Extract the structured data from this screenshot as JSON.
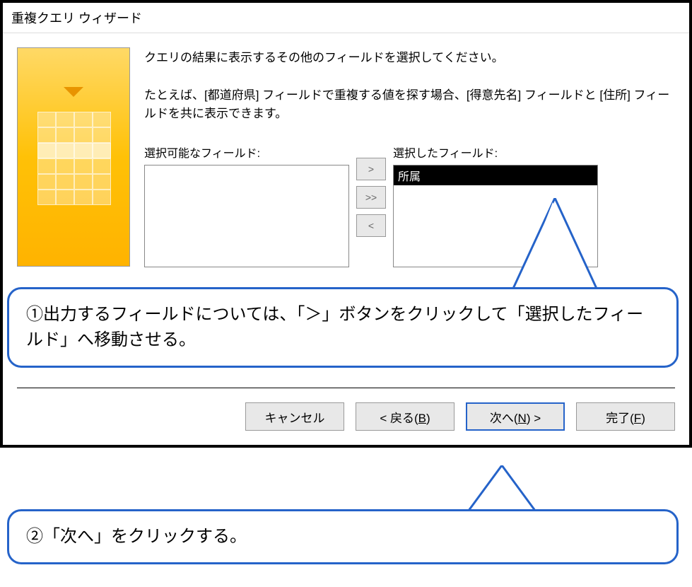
{
  "window": {
    "title": "重複クエリ ウィザード"
  },
  "instruction": "クエリの結果に表示するその他のフィールドを選択してください。",
  "example": "たとえば、[都道府県] フィールドで重複する値を探す場合、[得意先名] フィールドと [住所] フィールドを共に表示できます。",
  "fields": {
    "available_label": "選択可能なフィールド:",
    "selected_label": "選択したフィールド:",
    "selected_items": [
      "所属"
    ]
  },
  "transfer_buttons": {
    "add": ">",
    "add_all": ">>",
    "remove": "<"
  },
  "nav_buttons": {
    "cancel": "キャンセル",
    "back_prefix": "< 戻る(",
    "back_key": "B",
    "back_suffix": ")",
    "next_prefix": "次へ(",
    "next_key": "N",
    "next_suffix": ") >",
    "finish_prefix": "完了(",
    "finish_key": "F",
    "finish_suffix": ")"
  },
  "callouts": {
    "c1": "①出力するフィールドについては、「＞」ボタンをクリックして「選択したフィールド」へ移動させる。",
    "c2": "②「次へ」をクリックする。"
  }
}
